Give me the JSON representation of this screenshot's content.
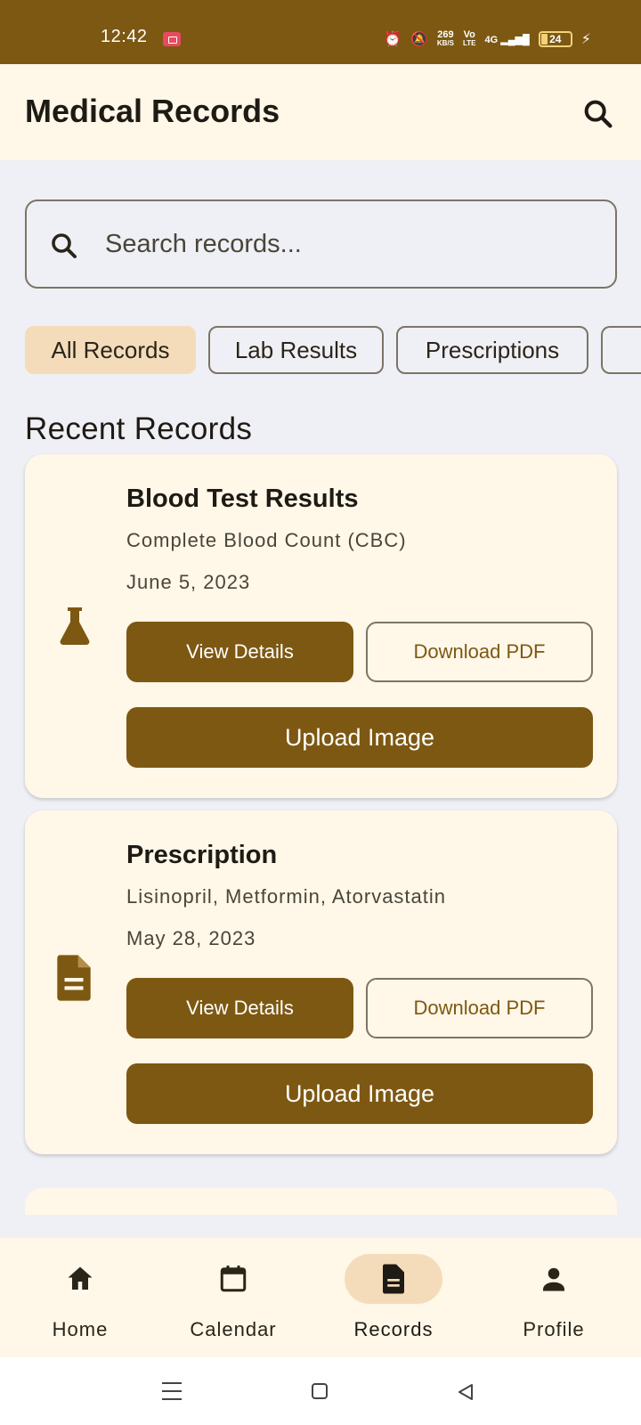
{
  "status_bar": {
    "time": "12:42",
    "speed_value": "269",
    "speed_unit": "KB/S",
    "volte_top": "Vo",
    "volte_bottom": "LTE",
    "network": "4G",
    "battery": "24"
  },
  "app_bar": {
    "title": "Medical Records",
    "search_icon": "search-icon"
  },
  "search": {
    "placeholder": "Search records..."
  },
  "filters": [
    "All Records",
    "Lab Results",
    "Prescriptions"
  ],
  "selected_filter": "All Records",
  "section_title": "Recent Records",
  "records": [
    {
      "title": "Blood Test Results",
      "subtitle": "Complete Blood Count (CBC)",
      "date": "June 5, 2023",
      "icon": "flask-icon",
      "view_label": "View Details",
      "download_label": "Download PDF",
      "upload_label": "Upload Image"
    },
    {
      "title": "Prescription",
      "subtitle": "Lisinopril, Metformin, Atorvastatin",
      "date": "May 28, 2023",
      "icon": "document-icon",
      "view_label": "View Details",
      "download_label": "Download PDF",
      "upload_label": "Upload Image"
    }
  ],
  "bottom_nav": [
    {
      "label": "Home",
      "icon": "home-icon"
    },
    {
      "label": "Calendar",
      "icon": "calendar-icon"
    },
    {
      "label": "Records",
      "icon": "document-icon"
    },
    {
      "label": "Profile",
      "icon": "person-icon"
    }
  ],
  "active_nav": "Records",
  "colors": {
    "primary": "#7d5812",
    "surface": "#fff7e8",
    "background": "#eff0f5",
    "selected_chip": "#f4dcba",
    "outline": "#7b7567"
  }
}
